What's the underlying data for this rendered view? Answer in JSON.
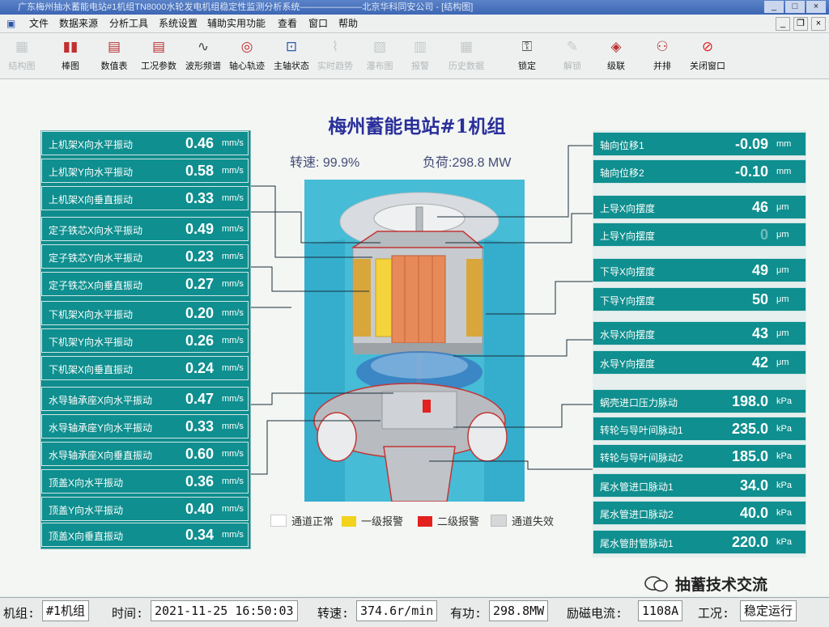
{
  "window": {
    "title": "广东梅州抽水蓄能电站#1机组TN8000水轮发电机组稳定性监测分析系统———————北京华科同安公司 - [结构图]"
  },
  "menu": [
    "文件",
    "数据来源",
    "分析工具",
    "系统设置",
    "辅助实用功能",
    "查看",
    "窗口",
    "帮助"
  ],
  "toolbar": [
    {
      "label": "结构图",
      "icon": "structure-icon",
      "enabled": false
    },
    {
      "label": "棒图",
      "icon": "bar-chart-icon",
      "enabled": true
    },
    {
      "label": "数值表",
      "icon": "table-icon",
      "enabled": true
    },
    {
      "label": "工况参数",
      "icon": "params-icon",
      "enabled": true
    },
    {
      "label": "波形频谱",
      "icon": "waveform-icon",
      "enabled": true
    },
    {
      "label": "轴心轨迹",
      "icon": "orbit-icon",
      "enabled": true
    },
    {
      "label": "主轴状态",
      "icon": "shaft-icon",
      "enabled": true
    },
    {
      "label": "实时趋势",
      "icon": "trend-icon",
      "enabled": false
    },
    {
      "label": "瀑布图",
      "icon": "waterfall-icon",
      "enabled": false
    },
    {
      "label": "报警",
      "icon": "alarm-icon",
      "enabled": false
    },
    {
      "label": "历史数据",
      "icon": "history-icon",
      "enabled": false
    },
    {
      "label": "锁定",
      "icon": "lock-icon",
      "enabled": true
    },
    {
      "label": "解锁",
      "icon": "unlock-icon",
      "enabled": false
    },
    {
      "label": "级联",
      "icon": "cascade-icon",
      "enabled": true
    },
    {
      "label": "并排",
      "icon": "tile-icon",
      "enabled": true
    },
    {
      "label": "关闭窗口",
      "icon": "close-window-icon",
      "enabled": true
    }
  ],
  "header": {
    "title": "梅州蓄能电站#1机组",
    "speed": "转速: 99.9%",
    "load": "负荷:298.8 MW"
  },
  "left_channels": [
    {
      "label": "上机架X向水平振动",
      "value": "0.46",
      "unit": "mm/s"
    },
    {
      "label": "上机架Y向水平振动",
      "value": "0.58",
      "unit": "mm/s"
    },
    {
      "label": "上机架X向垂直振动",
      "value": "0.33",
      "unit": "mm/s"
    },
    {
      "label": "定子铁芯X向水平振动",
      "value": "0.49",
      "unit": "mm/s"
    },
    {
      "label": "定子铁芯Y向水平振动",
      "value": "0.23",
      "unit": "mm/s"
    },
    {
      "label": "定子铁芯X向垂直振动",
      "value": "0.27",
      "unit": "mm/s"
    },
    {
      "label": "下机架X向水平振动",
      "value": "0.20",
      "unit": "mm/s"
    },
    {
      "label": "下机架Y向水平振动",
      "value": "0.26",
      "unit": "mm/s"
    },
    {
      "label": "下机架X向垂直振动",
      "value": "0.24",
      "unit": "mm/s"
    },
    {
      "label": "水导轴承座X向水平振动",
      "value": "0.47",
      "unit": "mm/s"
    },
    {
      "label": "水导轴承座Y向水平振动",
      "value": "0.33",
      "unit": "mm/s"
    },
    {
      "label": "水导轴承座X向垂直振动",
      "value": "0.60",
      "unit": "mm/s"
    },
    {
      "label": "顶盖X向水平振动",
      "value": "0.36",
      "unit": "mm/s"
    },
    {
      "label": "顶盖Y向水平振动",
      "value": "0.40",
      "unit": "mm/s"
    },
    {
      "label": "顶盖X向垂直振动",
      "value": "0.34",
      "unit": "mm/s"
    }
  ],
  "right_channels": [
    {
      "label": "轴向位移1",
      "value": "-0.09",
      "unit": "mm"
    },
    {
      "label": "轴向位移2",
      "value": "-0.10",
      "unit": "mm"
    },
    {
      "label": "上导X向摆度",
      "value": "46",
      "unit": "μm"
    },
    {
      "label": "上导Y向摆度",
      "value": "0",
      "unit": "μm",
      "dim": true
    },
    {
      "label": "下导X向摆度",
      "value": "49",
      "unit": "μm"
    },
    {
      "label": "下导Y向摆度",
      "value": "50",
      "unit": "μm"
    },
    {
      "label": "水导X向摆度",
      "value": "43",
      "unit": "μm"
    },
    {
      "label": "水导Y向摆度",
      "value": "42",
      "unit": "μm"
    },
    {
      "label": "蜗壳进口压力脉动",
      "value": "198.0",
      "unit": "kPa"
    },
    {
      "label": "转轮与导叶间脉动1",
      "value": "235.0",
      "unit": "kPa"
    },
    {
      "label": "转轮与导叶间脉动2",
      "value": "185.0",
      "unit": "kPa"
    },
    {
      "label": "尾水管进口脉动1",
      "value": "34.0",
      "unit": "kPa"
    },
    {
      "label": "尾水管进口脉动2",
      "value": "40.0",
      "unit": "kPa"
    },
    {
      "label": "尾水管肘管脉动1",
      "value": "220.0",
      "unit": "kPa"
    }
  ],
  "legend": [
    {
      "label": "通道正常",
      "color": "#ffffff"
    },
    {
      "label": "一级报警",
      "color": "#f2d21b"
    },
    {
      "label": "二级报警",
      "color": "#e3211f"
    },
    {
      "label": "通道失效",
      "color": "#d5d8d8"
    }
  ],
  "status": {
    "unit_label": "机组:",
    "unit_value": "#1机组",
    "time_label": "时间:",
    "time_value": "2021-11-25 16:50:03",
    "speed_label": "转速:",
    "speed_value": "374.6r/min",
    "power_label": "有功:",
    "power_value": "298.8MW",
    "excit_label": "励磁电流:",
    "excit_value": "1108A",
    "mode_label": "工况:",
    "mode_value": "稳定运行"
  },
  "watermark": "抽蓄技术交流"
}
